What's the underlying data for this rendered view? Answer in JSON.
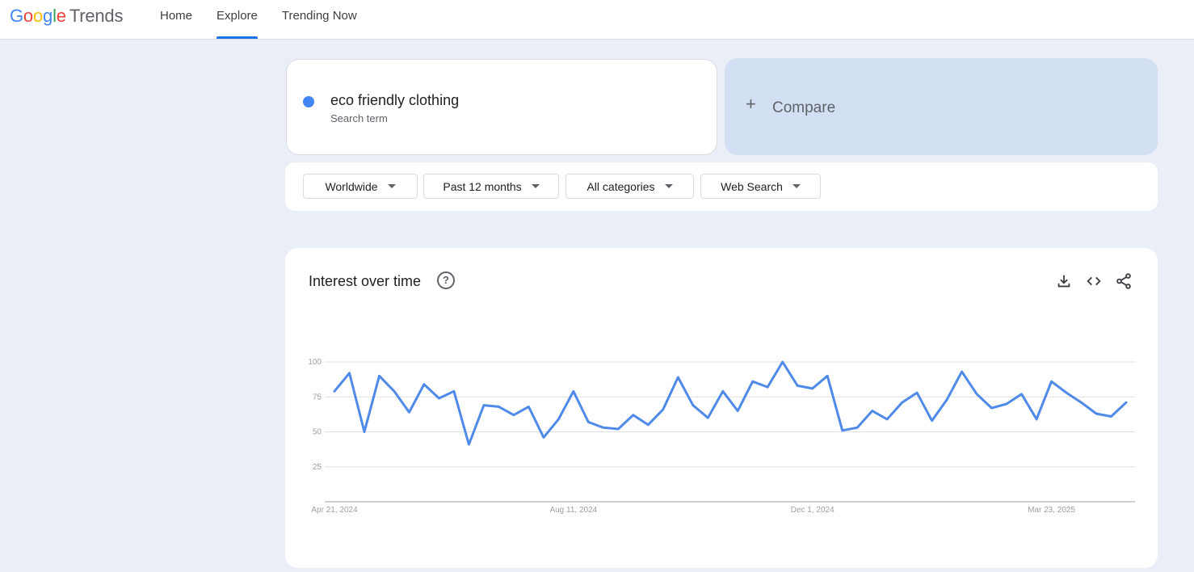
{
  "app": {
    "logo": {
      "google": [
        "G",
        "o",
        "o",
        "g",
        "l",
        "e"
      ],
      "product": "Trends"
    }
  },
  "nav": {
    "items": [
      {
        "label": "Home",
        "active": false
      },
      {
        "label": "Explore",
        "active": true
      },
      {
        "label": "Trending Now",
        "active": false
      }
    ]
  },
  "search": {
    "term": "eco friendly clothing",
    "term_type": "Search term",
    "term_color": "#4285f4",
    "compare_label": "Compare"
  },
  "filters": {
    "region": "Worldwide",
    "time_range": "Past 12 months",
    "category": "All categories",
    "search_type": "Web Search"
  },
  "chart_panel": {
    "title": "Interest over time",
    "actions": [
      "download-icon",
      "embed-code-icon",
      "share-icon"
    ]
  },
  "colors": {
    "accent": "#1a73e8",
    "series": "#4f8ae8",
    "compare_bg": "#d3e0f4",
    "page_bg": "#eaeef6"
  },
  "chart_data": {
    "type": "line",
    "title": "Interest over time",
    "xlabel": "",
    "ylabel": "",
    "ylim": [
      0,
      100
    ],
    "yticks": [
      25,
      50,
      75,
      100
    ],
    "grid": true,
    "x_tick_labels": [
      "Apr 21, 2024",
      "Aug 11, 2024",
      "Dec 1, 2024",
      "Mar 23, 2025"
    ],
    "x_tick_indices": [
      0,
      16,
      32,
      48
    ],
    "series": [
      {
        "values": [
          79,
          92,
          50,
          90,
          79,
          64,
          84,
          74,
          79,
          41,
          69,
          68,
          62,
          68,
          46,
          59,
          79,
          57,
          53,
          52,
          62,
          55,
          66,
          89,
          69,
          60,
          79,
          65,
          86,
          82,
          100,
          83,
          81,
          90,
          51,
          53,
          65,
          59,
          71,
          78,
          58,
          73,
          93,
          77,
          67,
          70,
          77,
          59,
          86,
          78,
          71,
          63,
          61,
          71
        ]
      }
    ]
  }
}
